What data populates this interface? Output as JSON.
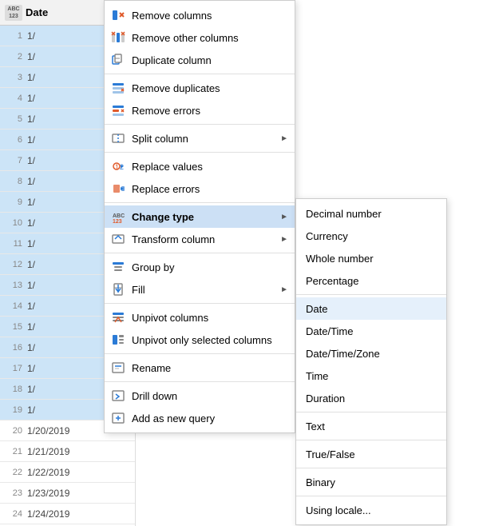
{
  "table": {
    "header": {
      "type_icon": "ABC\n123",
      "column_name": "Date"
    },
    "rows": [
      {
        "num": 1,
        "value": "1/",
        "selected": true
      },
      {
        "num": 2,
        "value": "1/",
        "selected": true
      },
      {
        "num": 3,
        "value": "1/",
        "selected": true
      },
      {
        "num": 4,
        "value": "1/",
        "selected": true
      },
      {
        "num": 5,
        "value": "1/",
        "selected": true
      },
      {
        "num": 6,
        "value": "1/",
        "selected": true
      },
      {
        "num": 7,
        "value": "1/",
        "selected": true
      },
      {
        "num": 8,
        "value": "1/",
        "selected": true
      },
      {
        "num": 9,
        "value": "1/",
        "selected": true
      },
      {
        "num": 10,
        "value": "1/",
        "selected": true
      },
      {
        "num": 11,
        "value": "1/",
        "selected": true
      },
      {
        "num": 12,
        "value": "1/",
        "selected": true
      },
      {
        "num": 13,
        "value": "1/",
        "selected": true
      },
      {
        "num": 14,
        "value": "1/",
        "selected": true
      },
      {
        "num": 15,
        "value": "1/",
        "selected": true
      },
      {
        "num": 16,
        "value": "1/",
        "selected": true
      },
      {
        "num": 17,
        "value": "1/",
        "selected": true
      },
      {
        "num": 18,
        "value": "1/",
        "selected": true
      },
      {
        "num": 19,
        "value": "1/",
        "selected": true
      },
      {
        "num": 20,
        "value": "1/20/2019",
        "selected": false
      },
      {
        "num": 21,
        "value": "1/21/2019",
        "selected": false
      },
      {
        "num": 22,
        "value": "1/22/2019",
        "selected": false
      },
      {
        "num": 23,
        "value": "1/23/2019",
        "selected": false
      },
      {
        "num": 24,
        "value": "1/24/2019",
        "selected": false
      }
    ]
  },
  "context_menu": {
    "items": [
      {
        "id": "remove-columns",
        "label": "Remove columns",
        "has_arrow": false,
        "icon": "remove-col-icon"
      },
      {
        "id": "remove-other-columns",
        "label": "Remove other columns",
        "has_arrow": false,
        "icon": "remove-other-icon"
      },
      {
        "id": "duplicate-column",
        "label": "Duplicate column",
        "has_arrow": false,
        "icon": "duplicate-icon"
      },
      {
        "id": "separator1"
      },
      {
        "id": "remove-duplicates",
        "label": "Remove duplicates",
        "has_arrow": false,
        "icon": "remove-dup-icon"
      },
      {
        "id": "remove-errors",
        "label": "Remove errors",
        "has_arrow": false,
        "icon": "remove-err-icon"
      },
      {
        "id": "separator2"
      },
      {
        "id": "split-column",
        "label": "Split column",
        "has_arrow": true,
        "icon": "split-icon"
      },
      {
        "id": "separator3"
      },
      {
        "id": "replace-values",
        "label": "Replace values",
        "has_arrow": false,
        "icon": "replace-val-icon"
      },
      {
        "id": "replace-errors",
        "label": "Replace errors",
        "has_arrow": false,
        "icon": "replace-err-icon"
      },
      {
        "id": "separator4"
      },
      {
        "id": "change-type",
        "label": "Change type",
        "has_arrow": true,
        "icon": "change-type-icon",
        "active": true
      },
      {
        "id": "transform-column",
        "label": "Transform column",
        "has_arrow": true,
        "icon": "transform-icon"
      },
      {
        "id": "separator5"
      },
      {
        "id": "group-by",
        "label": "Group by",
        "has_arrow": false,
        "icon": "group-icon"
      },
      {
        "id": "fill",
        "label": "Fill",
        "has_arrow": true,
        "icon": "fill-icon"
      },
      {
        "id": "separator6"
      },
      {
        "id": "unpivot-columns",
        "label": "Unpivot columns",
        "has_arrow": false,
        "icon": "unpivot-icon"
      },
      {
        "id": "unpivot-selected",
        "label": "Unpivot only selected columns",
        "has_arrow": false,
        "icon": "unpivot-sel-icon"
      },
      {
        "id": "separator7"
      },
      {
        "id": "rename",
        "label": "Rename",
        "has_arrow": false,
        "icon": "rename-icon"
      },
      {
        "id": "separator8"
      },
      {
        "id": "drill-down",
        "label": "Drill down",
        "has_arrow": false,
        "icon": "drill-icon"
      },
      {
        "id": "add-new-query",
        "label": "Add as new query",
        "has_arrow": false,
        "icon": "add-query-icon"
      }
    ]
  },
  "submenu": {
    "items": [
      {
        "id": "decimal-number",
        "label": "Decimal number"
      },
      {
        "id": "currency",
        "label": "Currency"
      },
      {
        "id": "whole-number",
        "label": "Whole number"
      },
      {
        "id": "percentage",
        "label": "Percentage"
      },
      {
        "id": "separator1"
      },
      {
        "id": "date",
        "label": "Date",
        "selected": true
      },
      {
        "id": "date-time",
        "label": "Date/Time"
      },
      {
        "id": "date-time-zone",
        "label": "Date/Time/Zone"
      },
      {
        "id": "time",
        "label": "Time"
      },
      {
        "id": "duration",
        "label": "Duration"
      },
      {
        "id": "separator2"
      },
      {
        "id": "text",
        "label": "Text"
      },
      {
        "id": "separator3"
      },
      {
        "id": "true-false",
        "label": "True/False"
      },
      {
        "id": "separator4"
      },
      {
        "id": "binary",
        "label": "Binary"
      },
      {
        "id": "separator5"
      },
      {
        "id": "using-locale",
        "label": "Using locale..."
      }
    ]
  }
}
